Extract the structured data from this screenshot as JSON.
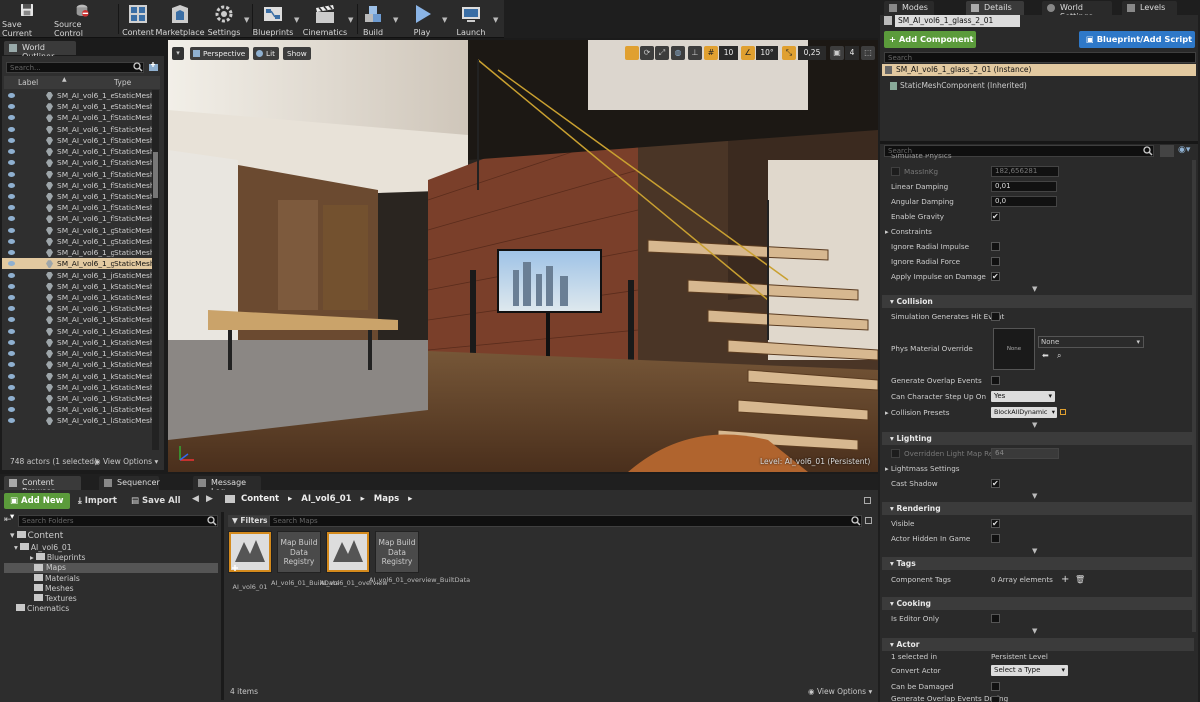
{
  "toolbar": {
    "items": [
      {
        "label": "Save Current",
        "icon": "save-icon"
      },
      {
        "label": "Source Control",
        "icon": "source-control-icon"
      },
      {
        "label": "Content",
        "icon": "content-icon"
      },
      {
        "label": "Marketplace",
        "icon": "marketplace-icon"
      },
      {
        "label": "Settings",
        "icon": "settings-icon"
      },
      {
        "label": "Blueprints",
        "icon": "blueprints-icon"
      },
      {
        "label": "Cinematics",
        "icon": "cinematics-icon"
      },
      {
        "label": "Build",
        "icon": "build-icon"
      },
      {
        "label": "Play",
        "icon": "play-icon"
      },
      {
        "label": "Launch",
        "icon": "launch-icon"
      }
    ]
  },
  "outliner": {
    "tab": "World Outliner",
    "search_placeholder": "Search...",
    "col_label": "Label",
    "col_type": "Type",
    "rows": [
      {
        "name": "SM_AI_vol6_1_en",
        "type": "StaticMesh",
        "sel": false
      },
      {
        "name": "SM_AI_vol6_1_ex",
        "type": "StaticMesh",
        "sel": false
      },
      {
        "name": "SM_AI_vol6_1_flc",
        "type": "StaticMesh",
        "sel": false
      },
      {
        "name": "SM_AI_vol6_1_flc",
        "type": "StaticMesh",
        "sel": false
      },
      {
        "name": "SM_AI_vol6_1_flc",
        "type": "StaticMesh",
        "sel": false
      },
      {
        "name": "SM_AI_vol6_1_flc",
        "type": "StaticMesh",
        "sel": false
      },
      {
        "name": "SM_AI_vol6_1_flc",
        "type": "StaticMesh",
        "sel": false
      },
      {
        "name": "SM_AI_vol6_1_flc",
        "type": "StaticMesh",
        "sel": false
      },
      {
        "name": "SM_AI_vol6_1_flc",
        "type": "StaticMesh",
        "sel": false
      },
      {
        "name": "SM_AI_vol6_1_flc",
        "type": "StaticMesh",
        "sel": false
      },
      {
        "name": "SM_AI_vol6_1_flc",
        "type": "StaticMesh",
        "sel": false
      },
      {
        "name": "SM_AI_vol6_1_flc",
        "type": "StaticMesh",
        "sel": false
      },
      {
        "name": "SM_AI_vol6_1_ga",
        "type": "StaticMesh",
        "sel": false
      },
      {
        "name": "SM_AI_vol6_1_gl",
        "type": "StaticMesh",
        "sel": false
      },
      {
        "name": "SM_AI_vol6_1_gl",
        "type": "StaticMesh",
        "sel": false
      },
      {
        "name": "SM_AI_vol6_1_gl",
        "type": "StaticMesh",
        "sel": true
      },
      {
        "name": "SM_AI_vol6_1_ju",
        "type": "StaticMesh",
        "sel": false
      },
      {
        "name": "SM_AI_vol6_1_kit",
        "type": "StaticMesh",
        "sel": false
      },
      {
        "name": "SM_AI_vol6_1_kit",
        "type": "StaticMesh",
        "sel": false
      },
      {
        "name": "SM_AI_vol6_1_kit",
        "type": "StaticMesh",
        "sel": false
      },
      {
        "name": "SM_AI_vol6_1_kit",
        "type": "StaticMesh",
        "sel": false
      },
      {
        "name": "SM_AI_vol6_1_kit",
        "type": "StaticMesh",
        "sel": false
      },
      {
        "name": "SM_AI_vol6_1_kit",
        "type": "StaticMesh",
        "sel": false
      },
      {
        "name": "SM_AI_vol6_1_kit",
        "type": "StaticMesh",
        "sel": false
      },
      {
        "name": "SM_AI_vol6_1_kit",
        "type": "StaticMesh",
        "sel": false
      },
      {
        "name": "SM_AI_vol6_1_kit",
        "type": "StaticMesh",
        "sel": false
      },
      {
        "name": "SM_AI_vol6_1_kit",
        "type": "StaticMesh",
        "sel": false
      },
      {
        "name": "SM_AI_vol6_1_kit",
        "type": "StaticMesh",
        "sel": false
      },
      {
        "name": "SM_AI_vol6_1_la",
        "type": "StaticMesh",
        "sel": false
      },
      {
        "name": "SM_AI_vol6_1_la",
        "type": "StaticMesh",
        "sel": false
      }
    ],
    "footer": "748 actors (1 selected)",
    "view_options": "View Options"
  },
  "viewport": {
    "perspective": "Perspective",
    "lit": "Lit",
    "show": "Show",
    "grid_snap": "10",
    "rot_snap": "10°",
    "scale_snap": "0,25",
    "cam_speed": "4",
    "level_label": "Level: AI_vol6_01 (Persistent)"
  },
  "bottom": {
    "tabs": [
      "Content Browser",
      "Sequencer",
      "Message Log"
    ],
    "add_new": "Add New",
    "import": "Import",
    "save_all": "Save All",
    "path": [
      "Content",
      "AI_vol6_01",
      "Maps"
    ],
    "search_folders": "Search Folders",
    "filters": "Filters",
    "search_maps": "Search Maps",
    "tree": [
      "Content",
      "AI_vol6_01",
      "Blueprints",
      "Maps",
      "Materials",
      "Meshes",
      "Textures",
      "Cinematics"
    ],
    "assets": [
      {
        "label": "AI_vol6_01",
        "thumb": ""
      },
      {
        "label": "AI_vol6_01_BuiltData",
        "thumb": "Map Build Data Registry"
      },
      {
        "label": "AI_vol6_01_overview",
        "thumb": ""
      },
      {
        "label": "AI_vol6_01_overview_BuiltData",
        "thumb": "Map Build Data Registry"
      }
    ],
    "items_count": "4 items",
    "view_options": "View Options"
  },
  "details": {
    "tabs": [
      "Modes",
      "Details",
      "World Settings",
      "Levels"
    ],
    "actor_name": "SM_AI_vol6_1_glass_2_01",
    "add_component": "+ Add Component",
    "blueprint": "Blueprint/Add Script",
    "search": "Search",
    "instance": "SM_AI_vol6_1_glass_2_01 (Instance)",
    "component": "StaticMeshComponent (Inherited)",
    "physics": {
      "sim_physics": "Simulate Physics",
      "mass_label": "MassInKg",
      "mass_value": "182,656281",
      "linear_damping": "Linear Damping",
      "linear_value": "0,01",
      "angular_damping": "Angular Damping",
      "angular_value": "0,0",
      "enable_gravity": "Enable Gravity",
      "constraints": "Constraints",
      "ignore_radial_impulse": "Ignore Radial Impulse",
      "ignore_radial_force": "Ignore Radial Force",
      "apply_impulse": "Apply Impulse on Damage"
    },
    "collision": {
      "title": "Collision",
      "sim_hit": "Simulation Generates Hit Event",
      "phys_mat": "Phys Material Override",
      "none": "None",
      "none_combo": "None",
      "overlap": "Generate Overlap Events",
      "step_up": "Can Character Step Up On",
      "step_up_value": "Yes",
      "presets": "Collision Presets",
      "presets_value": "BlockAllDynamic"
    },
    "lighting": {
      "title": "Lighting",
      "overridden": "Overridden Light Map Res",
      "overridden_value": "64",
      "lightmass": "Lightmass Settings",
      "cast_shadow": "Cast Shadow"
    },
    "rendering": {
      "title": "Rendering",
      "visible": "Visible",
      "hidden": "Actor Hidden In Game"
    },
    "tags": {
      "title": "Tags",
      "component_tags": "Component Tags",
      "array": "0 Array elements"
    },
    "cooking": {
      "title": "Cooking",
      "editor_only": "Is Editor Only"
    },
    "actor": {
      "title": "Actor",
      "selected_in": "1 selected in",
      "persistent": "Persistent Level",
      "convert": "Convert Actor",
      "select_type": "Select a Type",
      "can_be_damaged": "Can be Damaged",
      "generate_overlap": "Generate Overlap Events During"
    }
  }
}
